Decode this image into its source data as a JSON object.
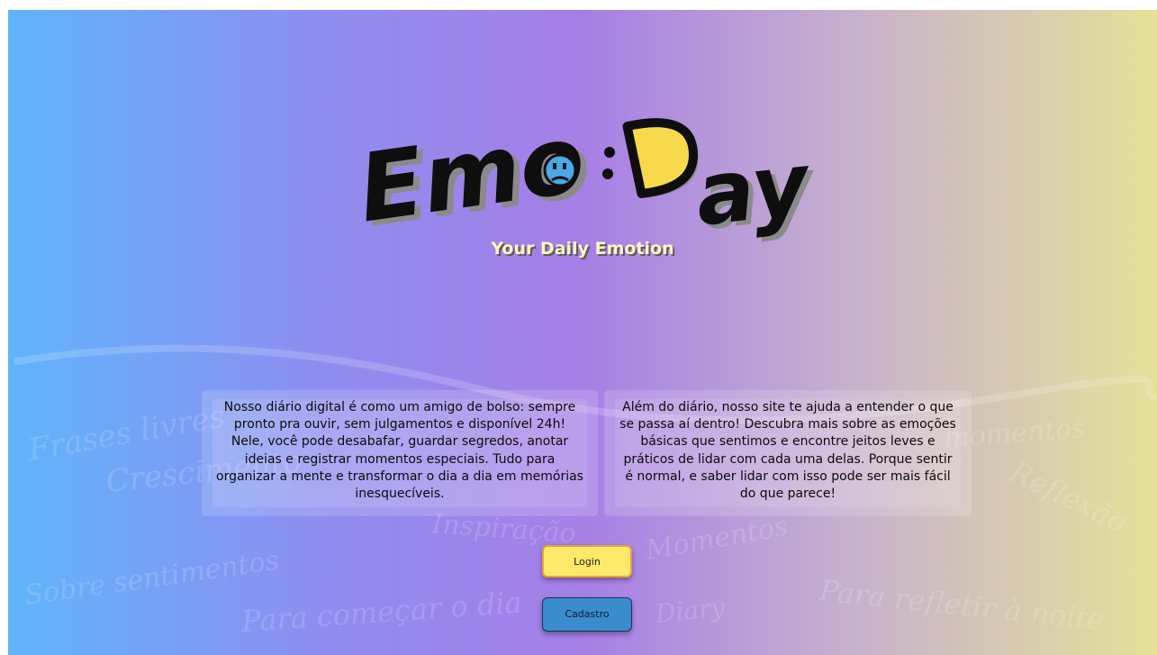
{
  "logo": {
    "text_left": "Emo",
    "text_right": "ay",
    "tagline": "Your Daily Emotion"
  },
  "background_phrases": [
    "Frases livres",
    "Crescimento",
    "Sobre sentimentos",
    "Para começar o dia",
    "Inspiração",
    "Momentos",
    "Diary",
    "momentos",
    "Reflexão",
    "Para refletir à noite"
  ],
  "cards": {
    "left_text": "Nosso diário digital é como um amigo de bolso: sempre pronto pra ouvir, sem julgamentos e disponível 24h! Nele, você pode desabafar, guardar segredos, anotar ideias e registrar momentos especiais. Tudo para organizar a mente e transformar o dia a dia em memórias inesquecíveis.",
    "right_text": "Além do diário, nosso site te ajuda a entender o que se passa aí dentro! Descubra mais sobre as emoções básicas que sentimos e encontre jeitos leves e práticos de lidar com cada uma delas. Porque sentir é normal, e saber lidar com isso pode ser mais fácil do que parece!"
  },
  "buttons": {
    "login": "Login",
    "signup": "Cadastro"
  },
  "colors": {
    "gradient_left": "#60b4fb",
    "gradient_mid": "#a67fe6",
    "gradient_right": "#e6e098",
    "login_button": "#fdea6b",
    "signup_button": "#3a8ccc",
    "logo_yellow": "#f8d94c",
    "logo_blue": "#4aa8e6"
  }
}
